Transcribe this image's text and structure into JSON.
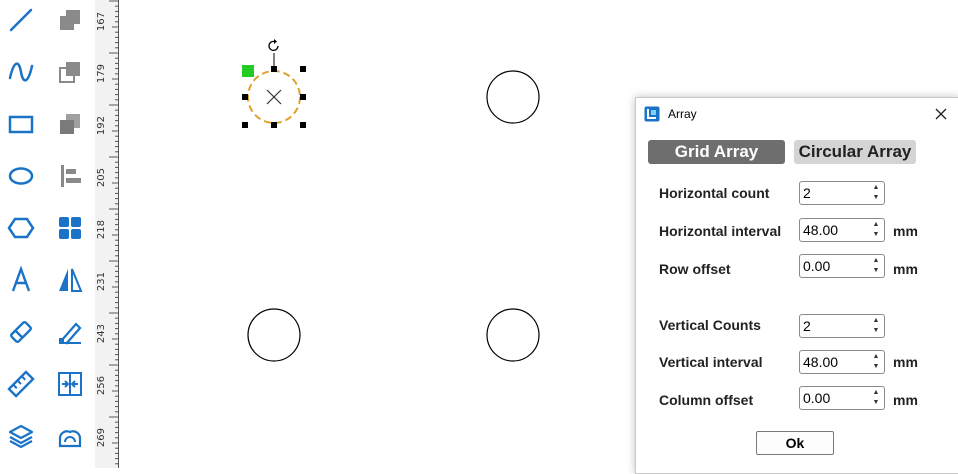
{
  "toolbar": {
    "tools_left": [
      {
        "name": "line-tool-icon"
      },
      {
        "name": "curve-tool-icon"
      },
      {
        "name": "rectangle-tool-icon"
      },
      {
        "name": "ellipse-tool-icon"
      },
      {
        "name": "polygon-tool-icon"
      },
      {
        "name": "text-tool-icon"
      },
      {
        "name": "eraser-tool-icon"
      },
      {
        "name": "measure-tool-icon"
      },
      {
        "name": "layers-icon"
      }
    ],
    "tools_right": [
      {
        "name": "bring-front-icon"
      },
      {
        "name": "copy-icon"
      },
      {
        "name": "send-back-icon"
      },
      {
        "name": "align-left-icon"
      },
      {
        "name": "array-grid-icon"
      },
      {
        "name": "mirror-icon"
      },
      {
        "name": "edit-node-icon"
      },
      {
        "name": "center-align-icon"
      },
      {
        "name": "weld-icon"
      }
    ],
    "accent_color": "#1a73c7"
  },
  "ruler": {
    "labels": [
      "167",
      "179",
      "192",
      "205",
      "218",
      "231",
      "243",
      "256",
      "269"
    ]
  },
  "canvas": {
    "selection_color": "#e0a030",
    "handle_color": "#000000",
    "anchor_color": "#22cc22"
  },
  "dialog": {
    "title": "Array",
    "tabs": {
      "grid": "Grid Array",
      "circular": "Circular Array"
    },
    "fields": {
      "h_count": {
        "label": "Horizontal count",
        "value": "2"
      },
      "h_interval": {
        "label": "Horizontal interval",
        "value": "48.00",
        "unit": "mm"
      },
      "row_offset": {
        "label": "Row offset",
        "value": "0.00",
        "unit": "mm"
      },
      "v_count": {
        "label": "Vertical Counts",
        "value": "2"
      },
      "v_interval": {
        "label": "Vertical interval",
        "value": "48.00",
        "unit": "mm"
      },
      "col_offset": {
        "label": "Column offset",
        "value": "0.00",
        "unit": "mm"
      }
    },
    "ok_label": "Ok"
  }
}
